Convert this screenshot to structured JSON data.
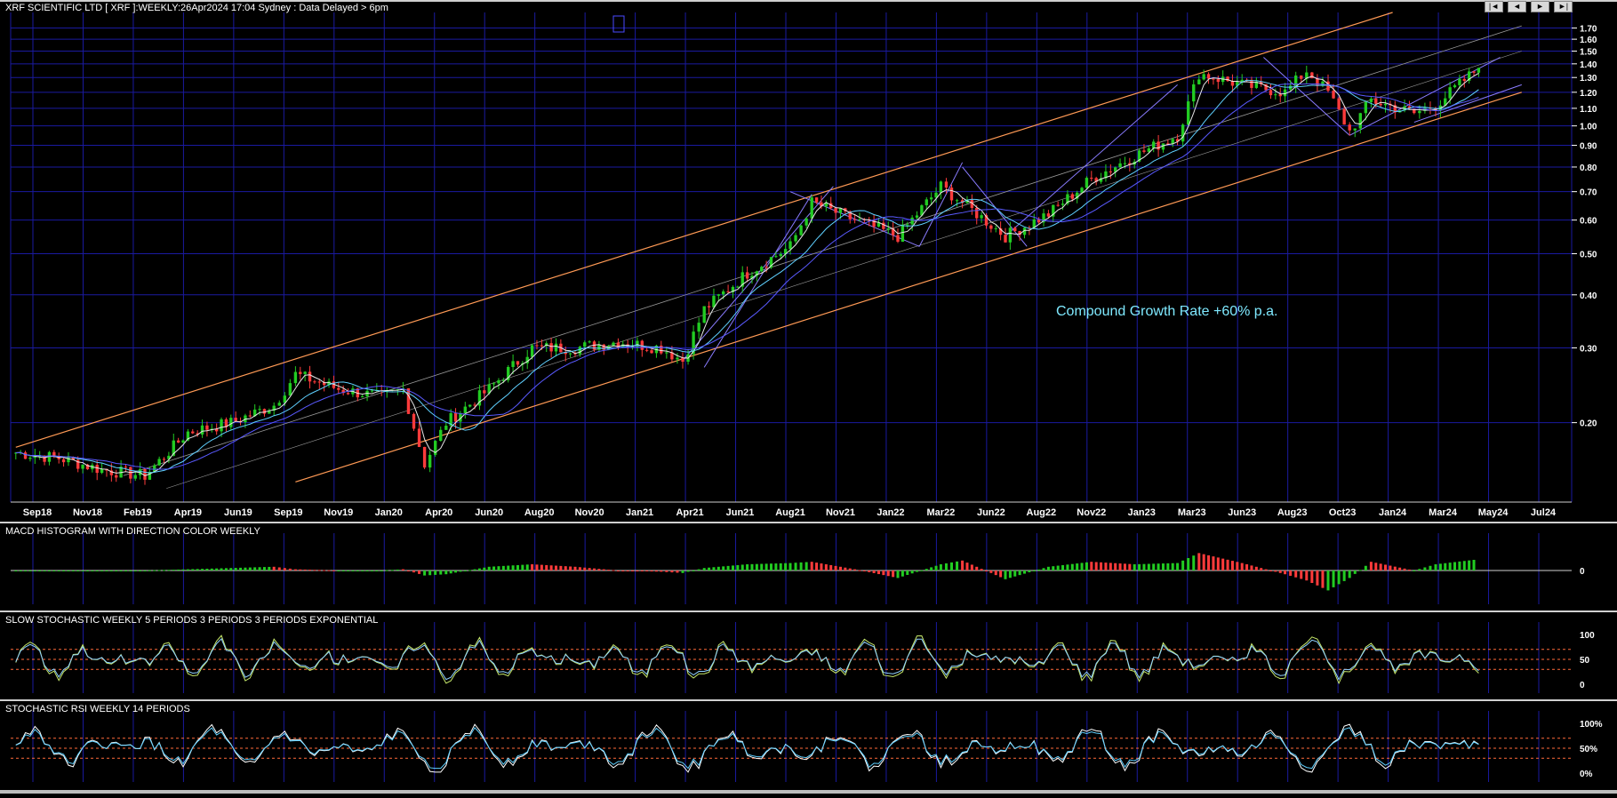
{
  "header": {
    "title": "XRF SCIENTIFIC LTD [ XRF ]:WEEKLY:26Apr2024 17:04 Sydney : Data Delayed > 6pm",
    "nav": [
      "|◄",
      "◄",
      "►",
      "►|"
    ]
  },
  "colors": {
    "background": "#000000",
    "grid": "#1a1aa0",
    "up_candle": "#22cc22",
    "down_candle": "#ff3b3b",
    "channel": "#ff9a55",
    "trend": "#8a7cff",
    "ma_fast": "#e8e8e8",
    "ma_slow": "#5fd0ff"
  },
  "chart_data": [
    {
      "type": "line",
      "name": "price",
      "title": "XRF SCIENTIFIC LTD [ XRF ]:WEEKLY:26Apr2024 17:04 Sydney : Data Delayed > 6pm",
      "scale": "log",
      "x_labels": [
        "Sep18",
        "Nov18",
        "Feb19",
        "Apr19",
        "Jun19",
        "Sep19",
        "Nov19",
        "Jan20",
        "Apr20",
        "Jun20",
        "Aug20",
        "Nov20",
        "Jan21",
        "Apr21",
        "Jun21",
        "Aug21",
        "Nov21",
        "Jan22",
        "Mar22",
        "Jun22",
        "Aug22",
        "Nov22",
        "Jan23",
        "Mar23",
        "Jun23",
        "Aug23",
        "Oct23",
        "Jan24",
        "Mar24",
        "May24",
        "Jul24"
      ],
      "y_ticks": [
        "0.20",
        "0.30",
        "0.40",
        "0.50",
        "0.60",
        "0.70",
        "0.80",
        "0.90",
        "1.00",
        "1.10",
        "1.20",
        "1.30",
        "1.40",
        "1.50",
        "1.60",
        "1.70"
      ],
      "ylim": [
        0.13,
        1.85
      ],
      "x": [
        "2018-08",
        "2018-10",
        "2018-12",
        "2019-02",
        "2019-04",
        "2019-06",
        "2019-08",
        "2019-09",
        "2019-11",
        "2020-01",
        "2020-02",
        "2020-03",
        "2020-04",
        "2020-06",
        "2020-08",
        "2020-10",
        "2020-12",
        "2021-02",
        "2021-03",
        "2021-04",
        "2021-06",
        "2021-08",
        "2021-09",
        "2021-11",
        "2022-01",
        "2022-03",
        "2022-04",
        "2022-06",
        "2022-08",
        "2022-10",
        "2022-12",
        "2023-02",
        "2023-03",
        "2023-05",
        "2023-07",
        "2023-08",
        "2023-09",
        "2023-10",
        "2023-11",
        "2024-01",
        "2024-02",
        "2024-04"
      ],
      "close": [
        0.17,
        0.165,
        0.155,
        0.15,
        0.19,
        0.2,
        0.22,
        0.26,
        0.24,
        0.23,
        0.24,
        0.16,
        0.2,
        0.24,
        0.3,
        0.3,
        0.31,
        0.3,
        0.28,
        0.37,
        0.45,
        0.52,
        0.66,
        0.6,
        0.55,
        0.72,
        0.66,
        0.55,
        0.62,
        0.75,
        0.85,
        0.95,
        1.33,
        1.25,
        1.2,
        1.35,
        1.2,
        0.97,
        1.15,
        1.07,
        1.12,
        1.37
      ],
      "annotation": "Compound Growth Rate   +60% p.a."
    },
    {
      "type": "bar",
      "name": "macd_histogram",
      "title": "MACD HISTOGRAM WITH DIRECTION COLOR WEEKLY",
      "y_ticks": [
        "0"
      ],
      "values": [
        0.0,
        0.0,
        0.0,
        0.0,
        0.1,
        0.2,
        0.3,
        0.1,
        0.0,
        0.0,
        0.1,
        -0.4,
        -0.3,
        0.3,
        0.5,
        0.3,
        0.0,
        -0.1,
        -0.2,
        0.2,
        0.5,
        0.6,
        0.7,
        0.1,
        -0.6,
        0.5,
        0.8,
        -0.7,
        0.3,
        0.7,
        0.5,
        0.6,
        1.4,
        0.6,
        -0.3,
        -0.8,
        -1.6,
        -0.6,
        0.7,
        0.0,
        0.5,
        0.9
      ]
    },
    {
      "type": "line",
      "name": "slow_stochastic",
      "title": "SLOW STOCHASTIC WEEKLY 5 PERIODS 3 PERIODS 3 PERIODS EXPONENTIAL",
      "y_ticks": [
        "100",
        "50",
        "0"
      ],
      "ylim": [
        0,
        100
      ],
      "levels": [
        70,
        50,
        30
      ],
      "period": 5
    },
    {
      "type": "line",
      "name": "stochastic_rsi",
      "title": "STOCHASTIC RSI WEEKLY 14 PERIODS",
      "y_ticks": [
        "100%",
        "50%",
        "0%"
      ],
      "ylim": [
        0,
        100
      ],
      "levels": [
        70,
        50,
        30
      ],
      "period": 14
    }
  ]
}
